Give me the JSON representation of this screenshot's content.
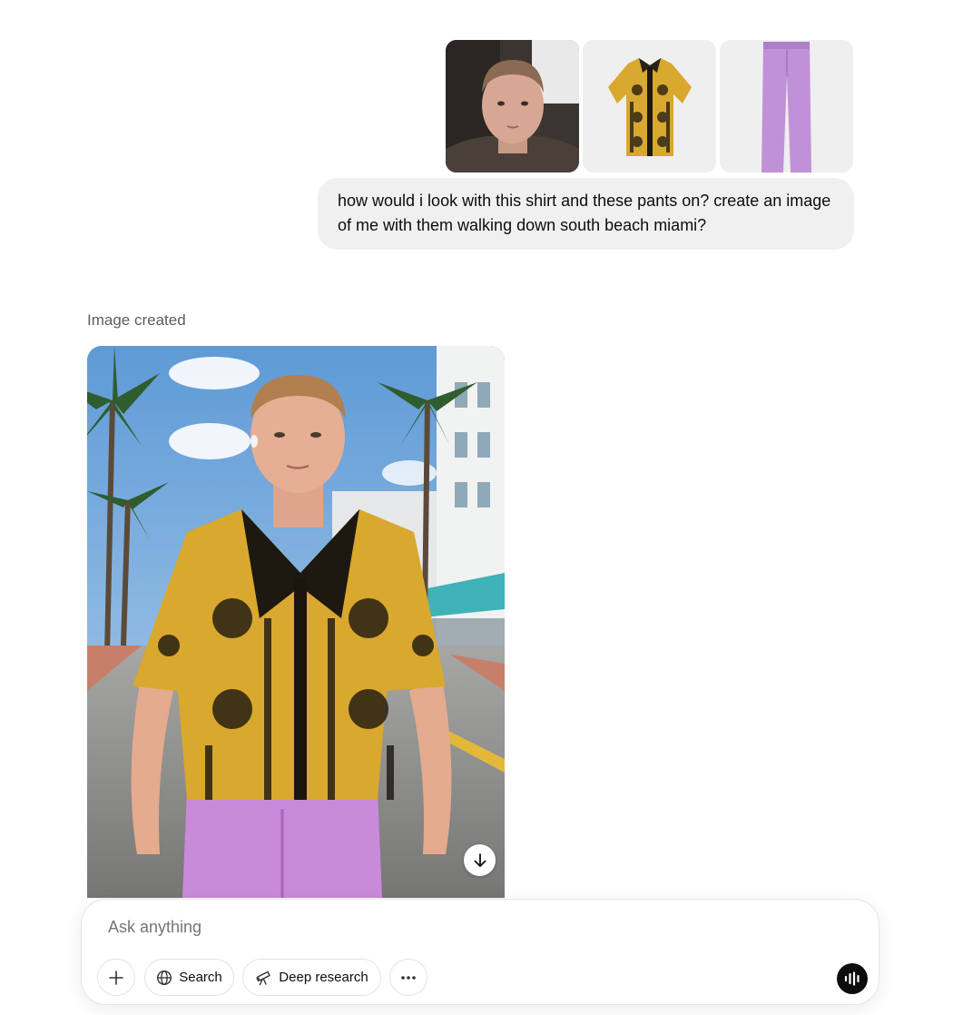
{
  "user_message": {
    "text": "how would i look with this shirt and these pants on? create an image of me with them walking down south beach miami?",
    "attachments": [
      {
        "icon": "portrait-photo-icon"
      },
      {
        "icon": "shirt-photo-icon"
      },
      {
        "icon": "pants-photo-icon"
      }
    ]
  },
  "assistant": {
    "status": "Image created",
    "image_icon": "generated-image",
    "download_icon": "download-arrow-icon"
  },
  "composer": {
    "placeholder": "Ask anything",
    "buttons": {
      "add_icon": "plus-icon",
      "search_label": "Search",
      "search_icon": "globe-icon",
      "research_label": "Deep research",
      "research_icon": "telescope-icon",
      "more_icon": "ellipsis-icon",
      "voice_icon": "voice-waveform-icon"
    }
  },
  "colors": {
    "bubble_bg": "#f0f0f0",
    "shirt_gold": "#d9a82e",
    "pants_lilac": "#c191d8",
    "voice_button": "#0d0d0d"
  }
}
